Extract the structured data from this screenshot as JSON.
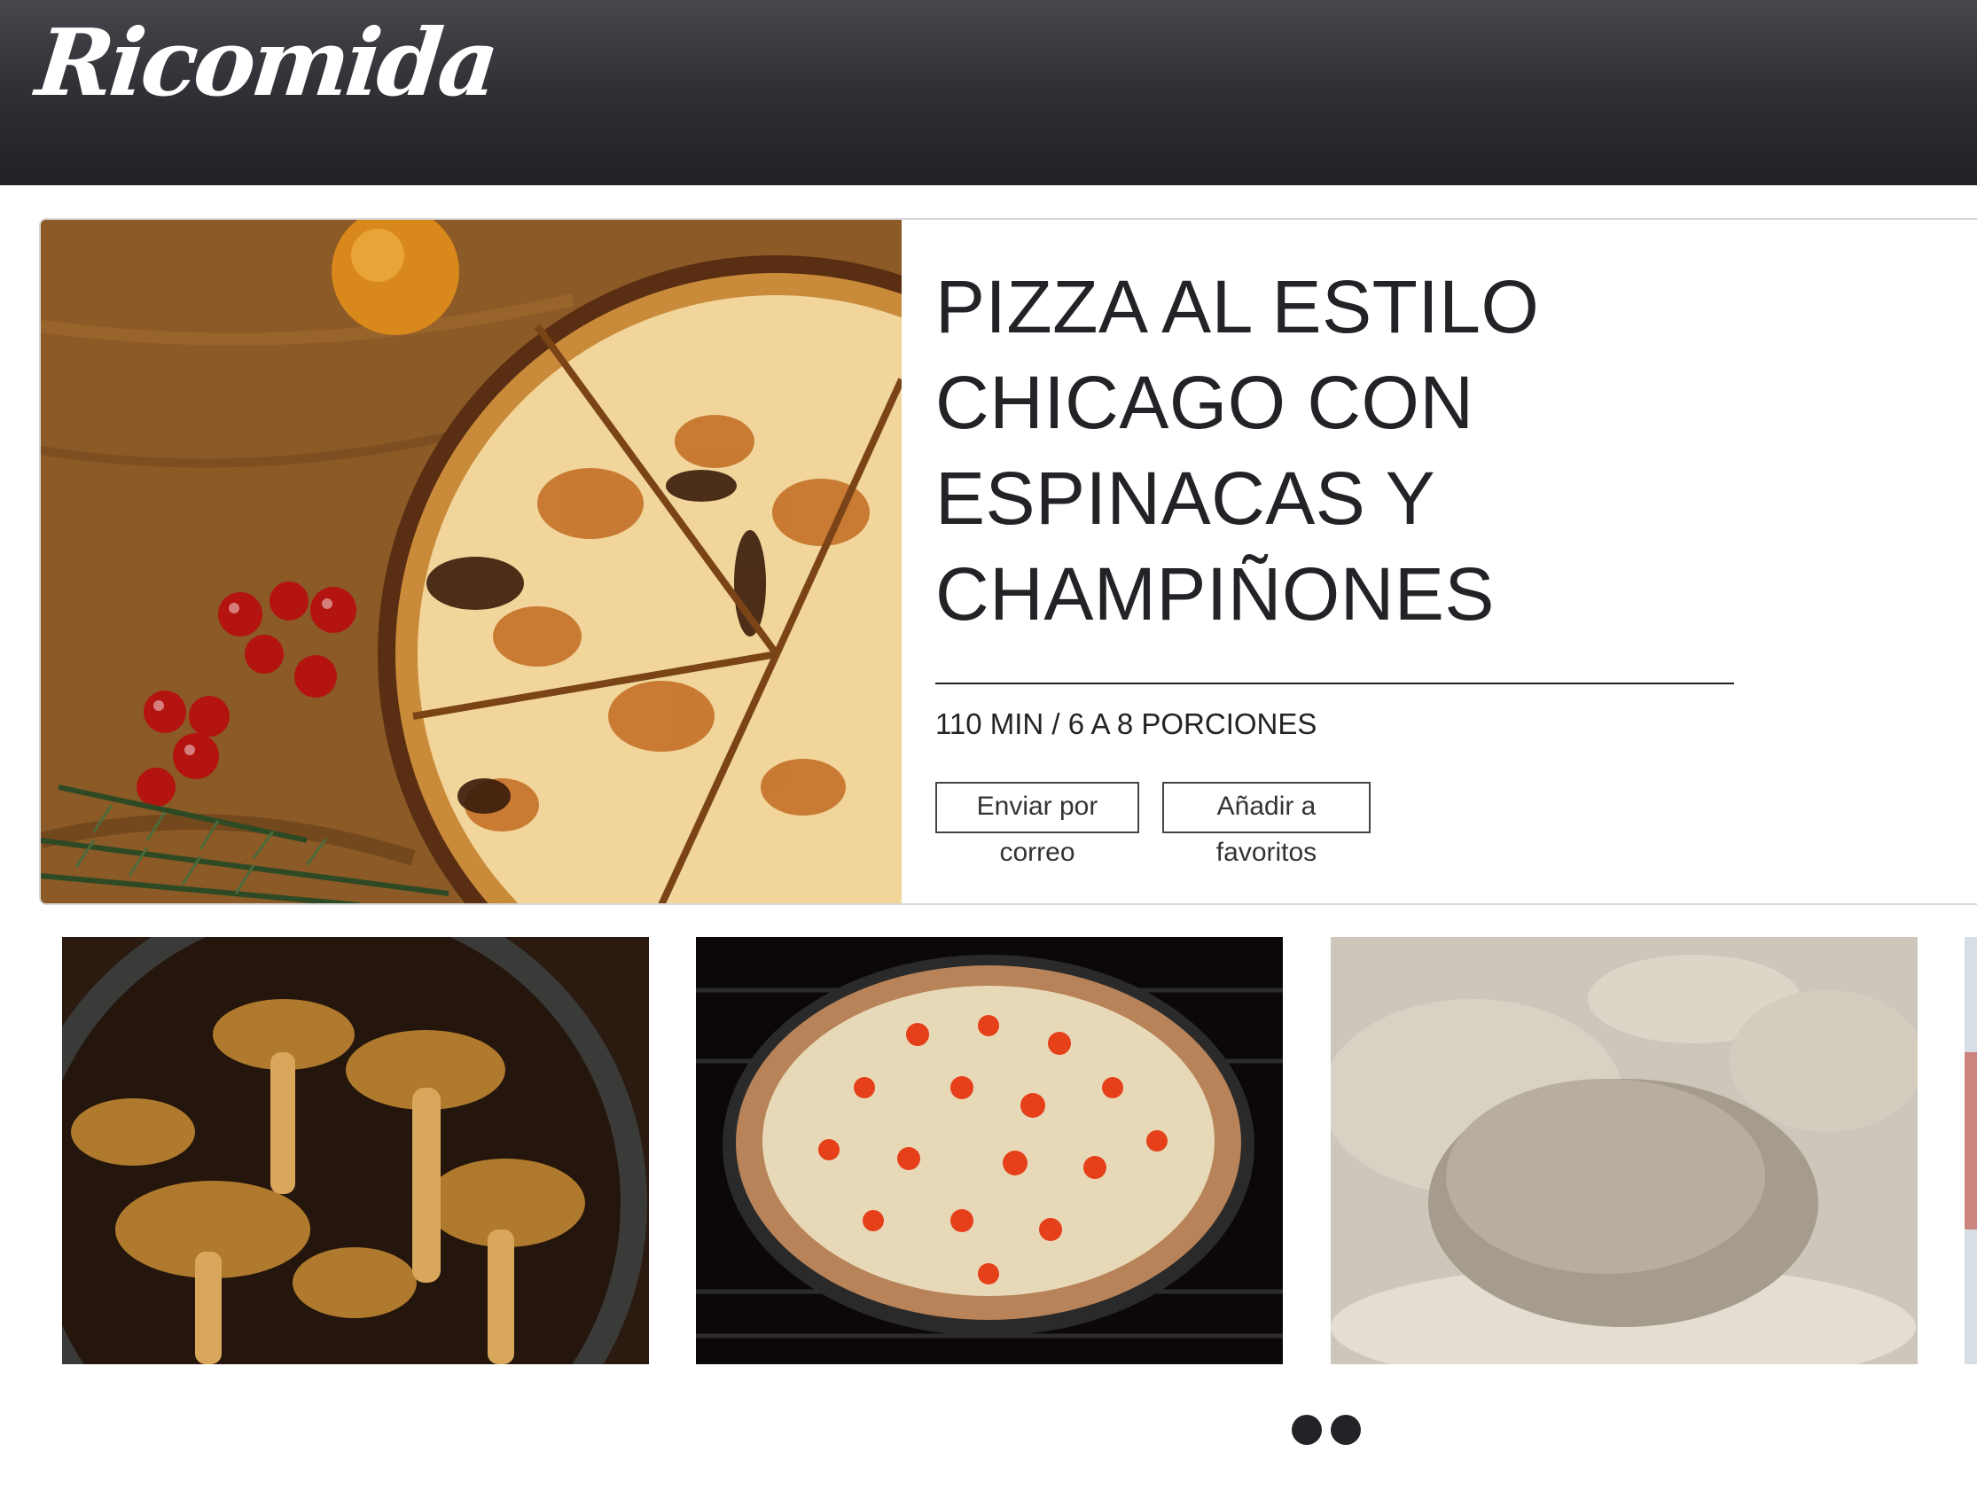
{
  "header": {
    "logo": "Ricomida"
  },
  "hero": {
    "image_icon": "pizza-photo",
    "title": "PIZZA AL ESTILO CHICAGO CON ESPINACAS Y CHAMPIÑONES",
    "meta": "110 MIN / 6 A 8 PORCIONES",
    "buttons": {
      "email": "Enviar por correo",
      "favorite": "Añadir a favoritos"
    }
  },
  "thumbnails": [
    {
      "icon": "mushrooms-photo"
    },
    {
      "icon": "pizza-in-oven-photo"
    },
    {
      "icon": "dough-photo"
    },
    {
      "icon": "partial-photo"
    }
  ],
  "carousel": {
    "dots": 2
  }
}
